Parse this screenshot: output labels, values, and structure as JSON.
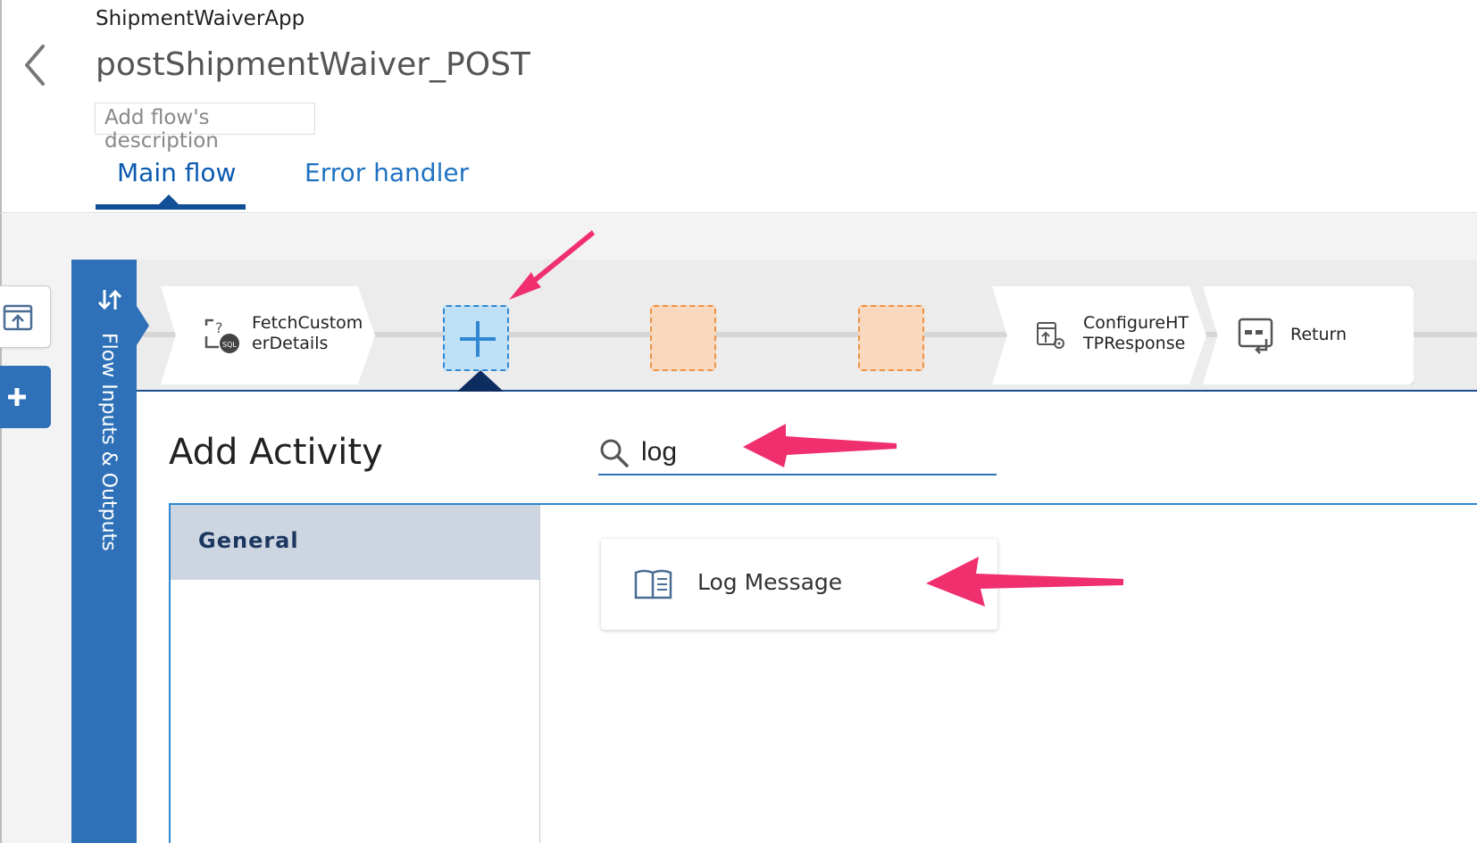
{
  "header": {
    "app_name": "ShipmentWaiverApp",
    "flow_name": "postShipmentWaiver_POST",
    "description_placeholder": "Add flow's description"
  },
  "tabs": [
    {
      "label": "Main flow",
      "active": true
    },
    {
      "label": "Error handler",
      "active": false
    }
  ],
  "io_panel": {
    "label": "Flow Inputs & Outputs",
    "icon": "swap-arrows-icon"
  },
  "pipeline": {
    "activities": [
      {
        "line1": "FetchCustom",
        "line2": "erDetails",
        "icon": "mysql-icon"
      },
      {
        "line1": "ConfigureHT",
        "line2": "TPResponse",
        "icon": "configure-response-icon"
      },
      {
        "line1": "Return",
        "icon": "return-icon"
      }
    ],
    "add_slot_icon": "plus-icon"
  },
  "add_activity": {
    "title": "Add Activity",
    "search_value": "log",
    "categories": [
      "General"
    ],
    "results": [
      {
        "label": "Log Message",
        "icon": "book-icon"
      }
    ]
  },
  "colors": {
    "primary_blue": "#2f71b8",
    "dark_navy": "#124f97",
    "add_slot_fill": "#bfe0f7",
    "empty_slot_fill": "#f8d8bf",
    "annotation_arrow": "#f0306e"
  }
}
